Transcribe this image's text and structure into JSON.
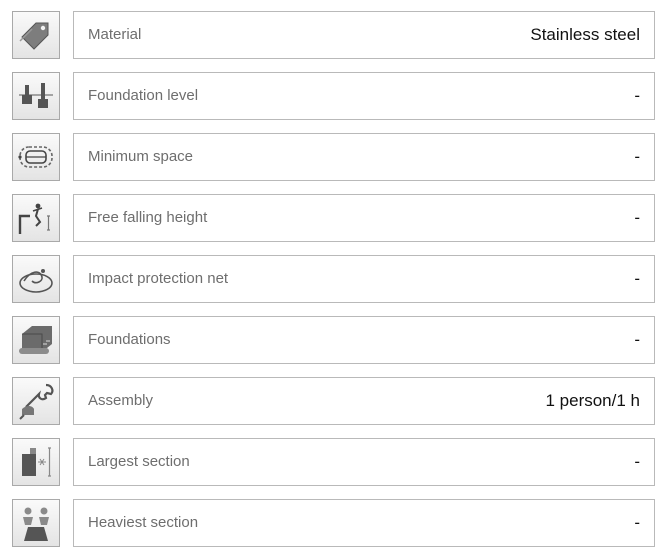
{
  "rows": [
    {
      "icon": "price-tag-icon",
      "label": "Material",
      "value": "Stainless steel"
    },
    {
      "icon": "foundation-level-icon",
      "label": "Foundation level",
      "value": "-"
    },
    {
      "icon": "minimum-space-icon",
      "label": "Minimum space",
      "value": "-"
    },
    {
      "icon": "falling-person-icon",
      "label": "Free falling height",
      "value": "-"
    },
    {
      "icon": "impact-net-icon",
      "label": "Impact protection net",
      "value": "-"
    },
    {
      "icon": "foundation-block-icon",
      "label": "Foundations",
      "value": "-"
    },
    {
      "icon": "wrench-hand-icon",
      "label": "Assembly",
      "value": "1 person/1 h"
    },
    {
      "icon": "largest-section-icon",
      "label": "Largest section",
      "value": "-"
    },
    {
      "icon": "weight-kg-icon",
      "label": "Heaviest section",
      "value": "-"
    }
  ]
}
